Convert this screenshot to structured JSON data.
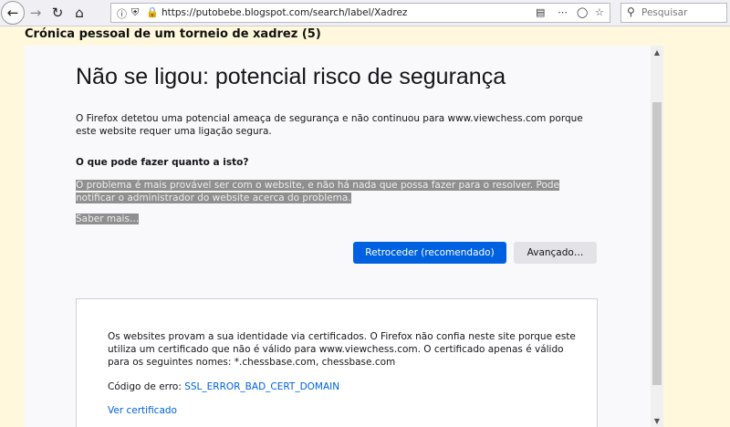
{
  "browser": {
    "url": "https://putobebe.blogspot.com/search/label/Xadrez",
    "search_placeholder": "Pesquisar"
  },
  "blog": {
    "post_title": "Crónica pessoal de um torneio de xadrez (5)"
  },
  "error_page": {
    "title": "Não se ligou: potencial risco de segurança",
    "description": "O Firefox detetou uma potencial ameaça de segurança e não continuou para www.viewchess.com porque este website requer uma ligação segura.",
    "what_title": "O que pode fazer quanto a isto?",
    "what_text": "O problema é mais provável ser com o website, e não há nada que possa fazer para o resolver. Pode notificar o administrador do website acerca do problema.",
    "learn_more": "Saber mais…",
    "back_button": "Retroceder (recomendado)",
    "advanced_button": "Avançado…",
    "advanced": {
      "text": "Os websites provam a sua identidade via certificados. O Firefox não confia neste site porque este utiliza um certificado que não é válido para www.viewchess.com. O certificado apenas é válido para os seguintes nomes: *.chessbase.com, chessbase.com",
      "error_code_label": "Código de erro:",
      "error_code": "SSL_ERROR_BAD_CERT_DOMAIN",
      "view_certificate": "Ver certificado"
    }
  },
  "icons": [
    "back-icon",
    "forward-icon",
    "reload-icon",
    "home-icon",
    "info-icon",
    "tracking-shield-icon",
    "insecure-lock-icon",
    "reader-view-icon",
    "more-icon",
    "pocket-icon",
    "star-icon",
    "search-icon"
  ],
  "colors": {
    "page_bg": "#fff8dc",
    "primary_button": "#0061e0",
    "link": "#0061e0"
  }
}
